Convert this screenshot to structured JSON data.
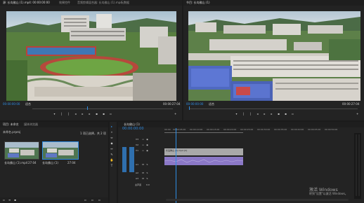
{
  "source_monitor": {
    "tab_active": "源: 长岛佛山 (1).mp4: 00:00:00:00",
    "tab2": "效果控件",
    "tab3": "音频剪辑混合器: 长岛佛山 (1).mp4",
    "tab4": "元数据",
    "timecode_left": "00:00:00:00",
    "fit_label": "适合",
    "timecode_right": "00:00:27:04"
  },
  "program_monitor": {
    "tab_active": "节目: 长岛佛山 (1)",
    "timecode_left": "00:00:00:00",
    "fit_label": "适合",
    "timecode_right": "00:00:27:04"
  },
  "project_panel": {
    "tab_active": "项目: 未命名",
    "tab2": "媒体浏览器",
    "path": "未命名.prproj",
    "count": "1 项已选择，共 2 项",
    "clips": [
      {
        "name": "长岛佛山 (1).mp4",
        "duration": "27:04"
      },
      {
        "name": "长岛佛山 (1)",
        "duration": "27:04"
      }
    ]
  },
  "timeline": {
    "tab_active": "长岛佛山 (1)",
    "timecode": "00:00:00:00",
    "ticks": [
      "00:00",
      "00:00:05:00",
      "00:00:10:00",
      "00:00:15:00",
      "00:00:20:00",
      "00:00:25:00",
      "00:00:30:00",
      "00:00:35:00",
      "00:00:40:00",
      "00:00:45:00",
      "00:00:50:00"
    ],
    "video_tracks": [
      "V3",
      "V2",
      "V1"
    ],
    "audio_tracks": [
      "A1",
      "A2",
      "A3"
    ],
    "master_label": "主声道",
    "master_value": "0.0",
    "clip_label": "长岛佛山 (1).mp4 [V]"
  },
  "watermark": {
    "line1": "激活 Windows",
    "line2": "转到\"设置\"以激活 Windows。"
  },
  "colors": {
    "accent": "#2f8de4",
    "video_clip": "#a9a9a9",
    "audio_clip": "#8b78c7"
  }
}
